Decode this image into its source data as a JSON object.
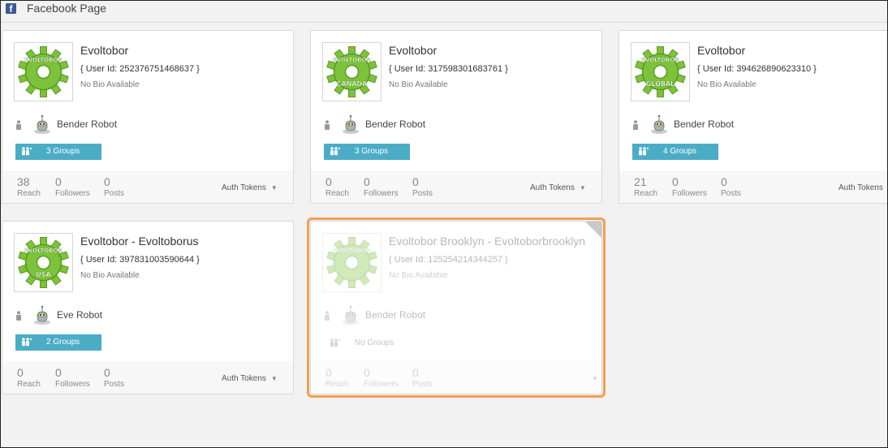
{
  "header": {
    "title": "Facebook Page",
    "fb_glyph": "f"
  },
  "stat_labels": {
    "reach": "Reach",
    "followers": "Followers",
    "posts": "Posts"
  },
  "cards": [
    {
      "name": "Evoltobor",
      "user_id": "{ User Id: 252376751468637 }",
      "bio": "No Bio Available",
      "robot": "Bender Robot",
      "logo_text": "EVOLTOBOR",
      "logo_sub": "",
      "groups": "3 Groups",
      "reach": "38",
      "followers": "0",
      "posts": "0",
      "auth": "Auth Tokens"
    },
    {
      "name": "Evoltobor",
      "user_id": "{ User Id: 317598301683761 }",
      "bio": "No Bio Available",
      "robot": "Bender Robot",
      "logo_text": "EVOLTOBOR",
      "logo_sub": "CANADA",
      "groups": "3 Groups",
      "reach": "0",
      "followers": "0",
      "posts": "0",
      "auth": "Auth Tokens"
    },
    {
      "name": "Evoltobor",
      "user_id": "{ User Id: 394626890623310 }",
      "bio": "No Bio Available",
      "robot": "Bender Robot",
      "logo_text": "EVOLTOBOR",
      "logo_sub": "GLOBAL",
      "groups": "4 Groups",
      "reach": "21",
      "followers": "0",
      "posts": "0",
      "auth": "Auth Tokens"
    },
    {
      "name": "Evoltobor - Evoltoborus",
      "user_id": "{ User Id: 397831003590644 }",
      "bio": "No Bio Available",
      "robot": "Eve Robot",
      "logo_text": "EVOLTOBOR",
      "logo_sub": "USA",
      "groups": "2 Groups",
      "reach": "0",
      "followers": "0",
      "posts": "0",
      "auth": "Auth Tokens"
    },
    {
      "name": "Evoltobor Brooklyn - Evoltoborbrooklyn",
      "user_id": "{ User Id: 125254214344257 }",
      "bio": "No Bio Available",
      "robot": "Bender Robot",
      "logo_text": "EVOLTOBOR",
      "logo_sub": "",
      "groups": "No Groups",
      "reach": "0",
      "followers": "0",
      "posts": "0",
      "auth": ""
    }
  ],
  "colors": {
    "accent": "#4bacc6",
    "selection": "#f0a050",
    "gear": "#7cc23a",
    "facebook": "#3b5998"
  },
  "icons": {
    "page": "facebook-icon",
    "person": "person-icon",
    "robot": "robot-icon",
    "groups": "groups-icon",
    "dropdown": "caret-down-icon"
  }
}
